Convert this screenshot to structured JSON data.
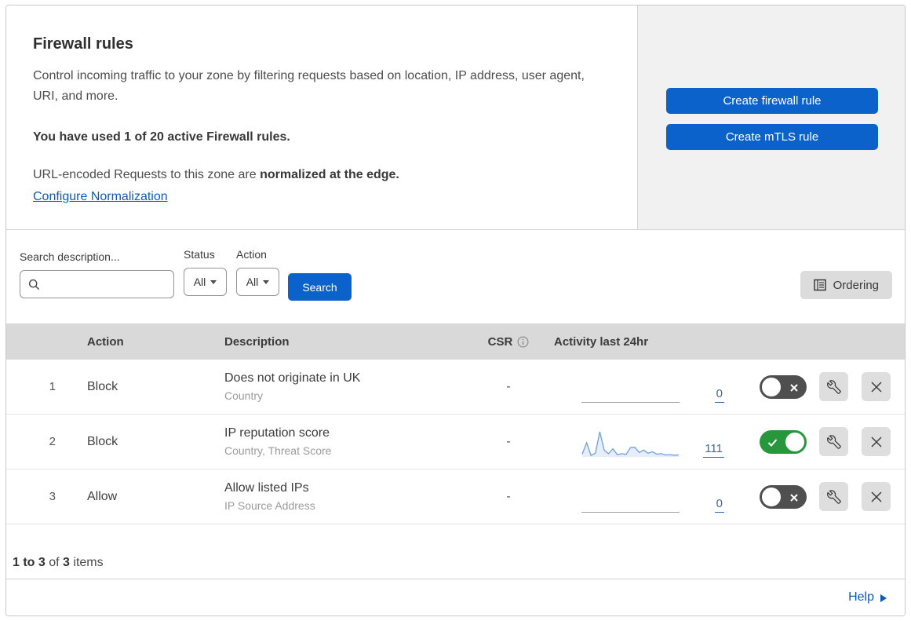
{
  "colors": {
    "primary_blue": "#0b62cb",
    "link_blue": "#0b5abe",
    "toggle_on_green": "#28963c",
    "toggle_off_gray": "#4f4f4f",
    "sparkline_blue": "#6f9fdc",
    "table_header_gray": "#d9d9d9",
    "side_panel_gray": "#f1f1f1"
  },
  "intro": {
    "title": "Firewall rules",
    "description": "Control incoming traffic to your zone by filtering requests based on location, IP address, user agent, URI, and more.",
    "usage": "You have used 1 of 20 active Firewall rules.",
    "normalization_prefix": "URL-encoded Requests to this zone are ",
    "normalization_bold": "normalized at the edge.",
    "link": "Configure Normalization"
  },
  "side_panel": {
    "create_firewall_label": "Create firewall rule",
    "create_mtls_label": "Create mTLS rule"
  },
  "filters": {
    "search_label": "Search description...",
    "search_value": "",
    "status_label": "Status",
    "status_value": "All",
    "action_label": "Action",
    "action_value": "All",
    "search_button": "Search",
    "ordering_button": "Ordering"
  },
  "table": {
    "columns": {
      "action": "Action",
      "description": "Description",
      "csr": "CSR",
      "activity": "Activity last 24hr"
    },
    "rows": [
      {
        "priority": "1",
        "action": "Block",
        "description": "Does not originate in UK",
        "fields": "Country",
        "csr": "-",
        "activity_count": "0",
        "enabled": false
      },
      {
        "priority": "2",
        "action": "Block",
        "description": "IP reputation score",
        "fields": "Country, Threat Score",
        "csr": "-",
        "activity_count": "111",
        "enabled": true,
        "sparkline": [
          8,
          55,
          3,
          12,
          100,
          25,
          10,
          30,
          6,
          10,
          7,
          35,
          36,
          15,
          25,
          12,
          18,
          8,
          10,
          5,
          6,
          4,
          5
        ]
      },
      {
        "priority": "3",
        "action": "Allow",
        "description": "Allow listed IPs",
        "fields": "IP Source Address",
        "csr": "-",
        "activity_count": "0",
        "enabled": false
      }
    ]
  },
  "footer": {
    "range": "1 to 3",
    "of": "of",
    "total": "3",
    "items": "items"
  },
  "help": {
    "label": "Help"
  }
}
